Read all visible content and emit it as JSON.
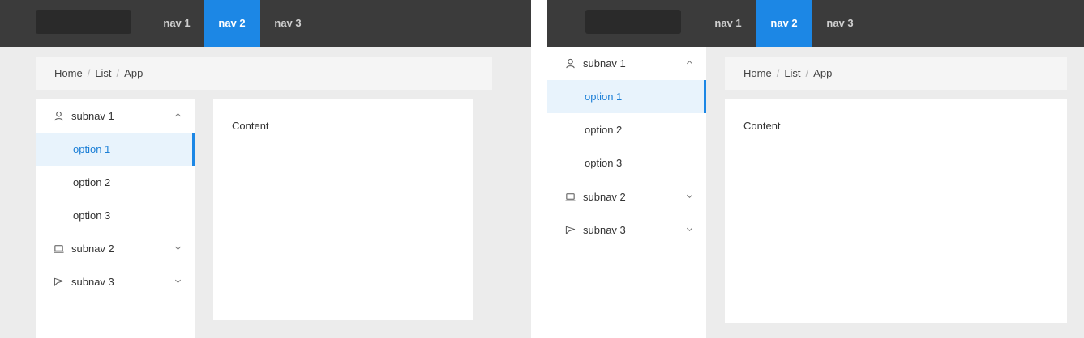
{
  "header": {
    "nav": [
      "nav 1",
      "nav 2",
      "nav 3"
    ],
    "active_nav": "nav 2"
  },
  "breadcrumb": [
    "Home",
    "List",
    "App"
  ],
  "breadcrumb_separator": "/",
  "sider": {
    "subnav1": {
      "label": "subnav 1",
      "icon": "user-icon",
      "expanded": true,
      "options": [
        "option 1",
        "option 2",
        "option 3"
      ],
      "selected": "option 1"
    },
    "subnav2": {
      "label": "subnav 2",
      "icon": "laptop-icon",
      "expanded": false
    },
    "subnav3": {
      "label": "subnav 3",
      "icon": "notification-icon",
      "expanded": false
    }
  },
  "content": {
    "text": "Content"
  },
  "colors": {
    "header_bg": "#3b3b3b",
    "accent": "#1c87e5",
    "selected_bg": "#e8f3fc",
    "page_bg": "#ececec"
  }
}
